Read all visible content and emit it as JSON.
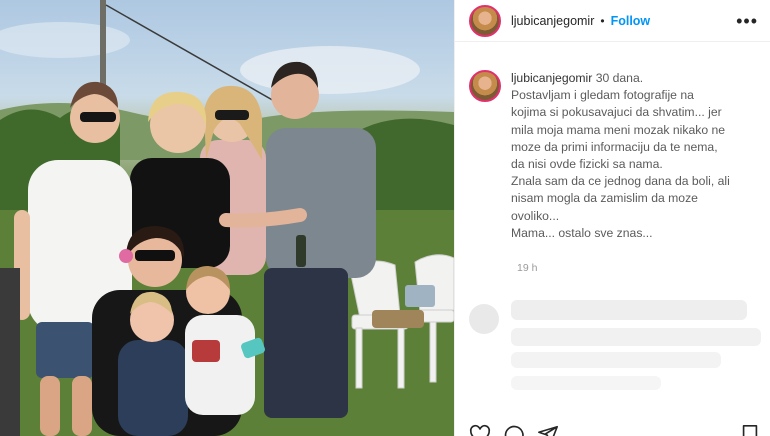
{
  "post": {
    "username": "ljubicanjegomir",
    "separator": "•",
    "follow_label": "Follow",
    "more_label": "•••",
    "caption_lines": [
      "30 dana.",
      "Postavljam i gledam fotografije na",
      "kojima si pokusavajuci da shvatim... jer",
      "mila moja mama meni mozak nikako ne",
      "moze da primi informaciju da te nema,",
      "da nisi ovde fizicki sa nama.",
      "Znala sam da ce jednog dana da boli, ali",
      "nisam mogla da zamislim da moze",
      "ovoliko...",
      "Mama... ostalo sve znas..."
    ],
    "time_ago": "19 h"
  },
  "icons": {
    "like": "heart-icon",
    "comment": "comment-icon",
    "share": "share-icon",
    "save": "bookmark-icon"
  },
  "colors": {
    "follow": "#0095f6",
    "avatar_ring": "#e1306c",
    "text": "#262626",
    "muted": "#8e8e8e"
  }
}
